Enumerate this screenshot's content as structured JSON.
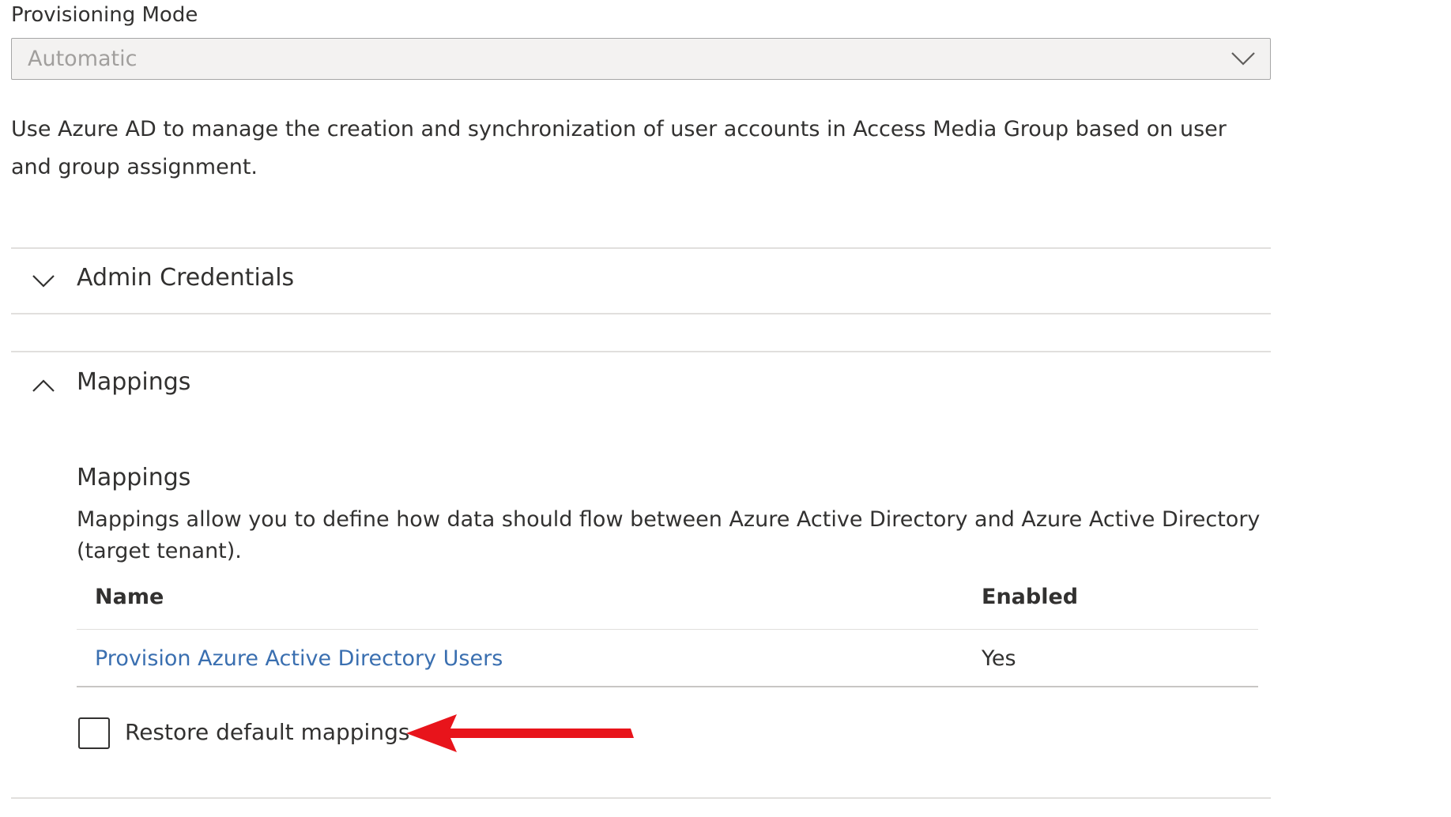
{
  "provisioning": {
    "label": "Provisioning Mode",
    "selected_value": "Automatic"
  },
  "description": "Use Azure AD to manage the creation and synchronization of user accounts in Access Media Group based on user and group assignment.",
  "sections": {
    "admin_credentials": {
      "title": "Admin Credentials",
      "expanded": false
    },
    "mappings": {
      "title": "Mappings",
      "expanded": true,
      "subtitle": "Mappings",
      "description": "Mappings allow you to define how data should flow between Azure Active Directory and Azure Active Directory (target tenant).",
      "table": {
        "headers": {
          "name": "Name",
          "enabled": "Enabled"
        },
        "rows": [
          {
            "name": "Provision Azure Active Directory Users",
            "enabled": "Yes"
          }
        ]
      },
      "restore_label": "Restore default mappings",
      "restore_checked": false
    }
  },
  "icons": {
    "dropdown": "chevron-down-icon",
    "admin_credentials_toggle": "chevron-down-icon",
    "mappings_toggle": "chevron-up-icon",
    "annotation": "red-arrow-icon"
  },
  "colors": {
    "link": "#3a6fb0",
    "annotation_arrow": "#e8141b",
    "dropdown_bg": "#f3f2f1"
  }
}
